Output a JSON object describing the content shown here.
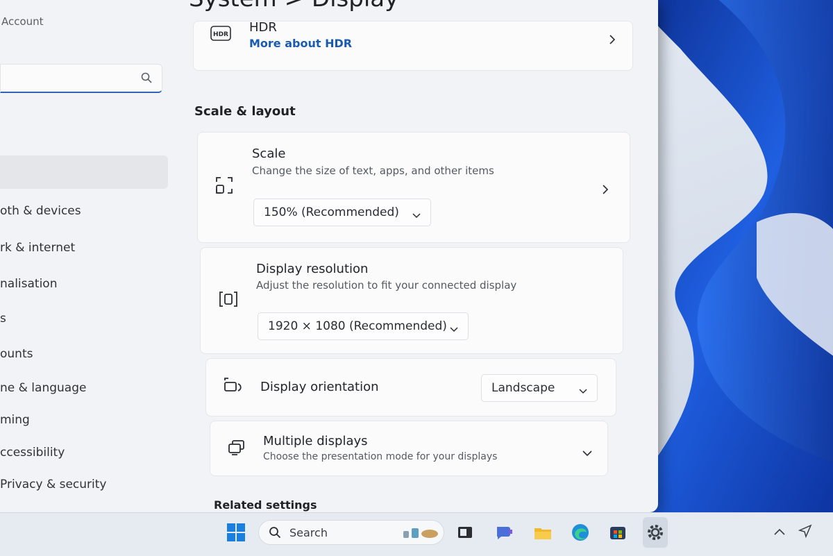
{
  "window": {
    "page_title": "System  >  Display",
    "sidebar": {
      "account_label": "Account",
      "search_icon": "search-icon",
      "items": [
        {
          "label": "oth & devices"
        },
        {
          "label": "rk & internet"
        },
        {
          "label": "nalisation"
        },
        {
          "label": "s"
        },
        {
          "label": "ounts"
        },
        {
          "label": "ne & language"
        },
        {
          "label": "ming"
        },
        {
          "label": "ccessibility"
        },
        {
          "label": "Privacy & security"
        }
      ]
    },
    "hdr": {
      "title": "HDR",
      "link": "More about HDR",
      "icon": "hdr-icon"
    },
    "section_heading": "Scale & layout",
    "scale": {
      "title": "Scale",
      "subtitle": "Change the size of text, apps, and other items",
      "value": "150% (Recommended)",
      "icon": "scale-icon"
    },
    "resolution": {
      "title": "Display resolution",
      "subtitle": "Adjust the resolution to fit your connected display",
      "value": "1920 × 1080 (Recommended)",
      "icon": "resolution-icon"
    },
    "orientation": {
      "title": "Display orientation",
      "value": "Landscape",
      "icon": "orientation-icon"
    },
    "multiple": {
      "title": "Multiple displays",
      "subtitle": "Choose the presentation mode for your displays",
      "icon": "multiple-displays-icon"
    },
    "related_heading": "Related settings"
  },
  "taskbar": {
    "search_label": "Search",
    "icons": [
      "windows-start-icon",
      "search-icon",
      "task-view-icon",
      "chat-icon",
      "file-explorer-icon",
      "edge-icon",
      "store-icon",
      "settings-icon",
      "chevron-up-icon",
      "send-icon"
    ]
  },
  "colors": {
    "accent": "#2f63b5",
    "link": "#1a5bb0"
  }
}
